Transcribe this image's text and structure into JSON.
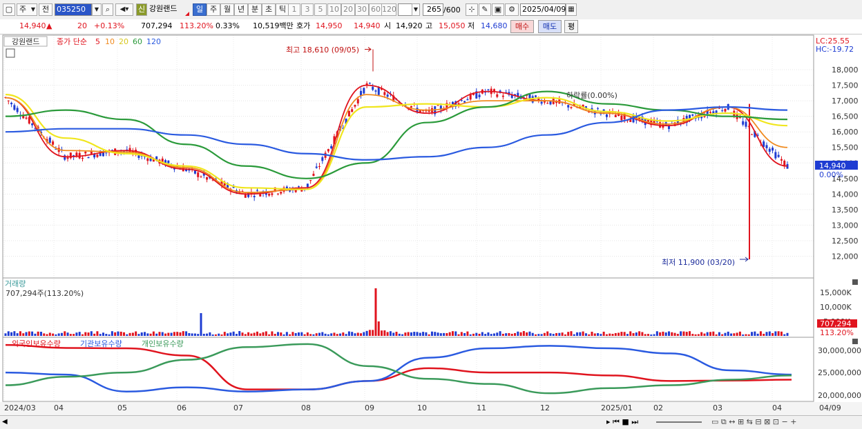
{
  "toolbar": {
    "period_label": "주",
    "prev_label": "전",
    "stock_code": "035250",
    "badge_label": "신",
    "stock_name": "강원랜드",
    "timeframes": [
      "일",
      "주",
      "월",
      "년",
      "분",
      "초",
      "틱"
    ],
    "active_timeframe": "일",
    "intervals": [
      "1",
      "3",
      "5",
      "10",
      "20",
      "30",
      "60",
      "120"
    ],
    "count_value": "265",
    "count_total": "/600",
    "date_value": "2025/04/09"
  },
  "quote": {
    "price": "14,940",
    "change_arrow": "▲",
    "change": "20",
    "change_pct": "+0.13%",
    "volume": "707,294",
    "volume_ratio": "113.20%",
    "turnover_pct": "0.33%",
    "amount": "10,519백만",
    "bid_label": "호가",
    "bid1": "14,950",
    "bid2": "14,940",
    "open_label": "시",
    "open": "14,920",
    "high_label": "고",
    "high": "15,050",
    "low_label": "저",
    "low": "14,680",
    "buy_label": "매수",
    "sell_label": "매도",
    "eval_label": "평"
  },
  "legend": {
    "name": "강원랜드",
    "ma_prefix": "종가 단순",
    "ma5": "5",
    "ma10": "10",
    "ma20": "20",
    "ma60": "60",
    "ma120": "120"
  },
  "annotations": {
    "high": "최고 18,610 (09/05)",
    "low": "최저 11,900 (03/20)",
    "drop": "하락률(0.00%)",
    "lc": "LC:25.55",
    "hc": "HC:-19.72",
    "price_tag": "14,940",
    "pct_tag": "0.00%"
  },
  "volume_panel": {
    "title": "거래량",
    "value": "707,294주(113.20%)",
    "tag_value": "707,294",
    "tag_pct": "113.20%",
    "axis": [
      "15,000K",
      "10,000K",
      "5,000K"
    ]
  },
  "holdings_panel": {
    "foreign": "외국인보유수량",
    "institution": "기관보유수량",
    "individual": "개인보유수량",
    "axis": [
      "30,000,000",
      "25,000,000",
      "20,000,000"
    ]
  },
  "price_axis": [
    "18,000",
    "17,500",
    "17,000",
    "16,500",
    "16,000",
    "15,500",
    "15,000",
    "14,500",
    "14,000",
    "13,500",
    "13,000",
    "12,500",
    "12,000"
  ],
  "x_axis": [
    "2024/03",
    "04",
    "05",
    "06",
    "07",
    "08",
    "09",
    "10",
    "11",
    "12",
    "2025/01",
    "02",
    "03",
    "04",
    "04/09"
  ],
  "colors": {
    "up": "#e0141e",
    "down": "#1e3cd2",
    "ma5": "#e0141e",
    "ma10": "#f08a1e",
    "ma20": "#f0e61e",
    "ma60": "#2a9a3a",
    "ma120": "#2a5ae0",
    "foreign": "#e0141e",
    "institution": "#2a5ae0",
    "individual": "#3a9a5a"
  },
  "chart_data": {
    "type": "line",
    "x": [
      "2024/03",
      "04",
      "05",
      "06",
      "07",
      "08",
      "09",
      "10",
      "11",
      "12",
      "2025/01",
      "02",
      "03",
      "04"
    ],
    "ylim": [
      11700,
      18600
    ],
    "series": [
      {
        "name": "5",
        "values": [
          17100,
          15200,
          15400,
          14800,
          14000,
          14200,
          17500,
          16600,
          17300,
          17000,
          16600,
          16200,
          16800,
          14900
        ]
      },
      {
        "name": "10",
        "values": [
          17100,
          15400,
          15350,
          14850,
          14050,
          14150,
          17200,
          16700,
          17000,
          17000,
          16600,
          16250,
          16800,
          15500
        ]
      },
      {
        "name": "20",
        "values": [
          17200,
          15800,
          15300,
          14900,
          14200,
          14150,
          16800,
          16900,
          16800,
          17100,
          16650,
          16350,
          16600,
          16200
        ]
      },
      {
        "name": "60",
        "values": [
          16500,
          16700,
          16400,
          15600,
          14900,
          14500,
          15000,
          16300,
          16800,
          17300,
          16900,
          16700,
          16500,
          16400
        ]
      },
      {
        "name": "120",
        "values": [
          16000,
          16100,
          16100,
          15900,
          15600,
          15300,
          15100,
          15200,
          15500,
          15900,
          16300,
          16700,
          16800,
          16700
        ]
      }
    ]
  }
}
